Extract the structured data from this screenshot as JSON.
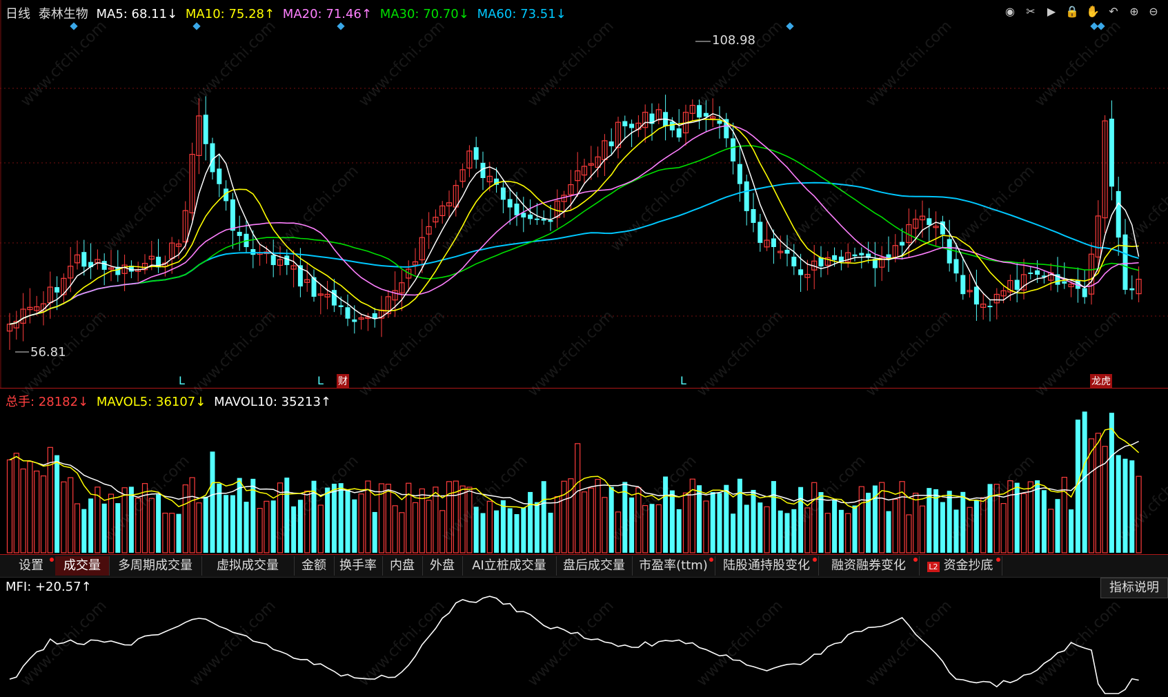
{
  "price_header": {
    "period": "日线",
    "stock_name": "泰林生物",
    "ma5": "MA5: 68.11↓",
    "ma10": "MA10: 75.28↑",
    "ma20": "MA20: 71.46↑",
    "ma30": "MA30: 70.70↓",
    "ma60": "MA60: 73.51↓"
  },
  "price_annotations": {
    "high": "108.98",
    "low": "56.81",
    "marker_l": "L",
    "marker_cai": "财",
    "marker_longhu": "龙虎"
  },
  "volume_header": {
    "total": "总手: 28182↓",
    "mavol5": "MAVOL5: 36107↓",
    "mavol10": "MAVOL10: 35213↑"
  },
  "tabs": [
    {
      "label": "设置",
      "dot": true
    },
    {
      "label": "成交量",
      "dot": false,
      "active": true
    },
    {
      "label": "多周期成交量",
      "dot": false
    },
    {
      "label": "虚拟成交量",
      "dot": false
    },
    {
      "label": "金额",
      "dot": false
    },
    {
      "label": "换手率",
      "dot": false
    },
    {
      "label": "内盘",
      "dot": false
    },
    {
      "label": "外盘",
      "dot": false
    },
    {
      "label": "AI立桩成交量",
      "dot": false
    },
    {
      "label": "盘后成交量",
      "dot": false
    },
    {
      "label": "市盈率(ttm)",
      "dot": true
    },
    {
      "label": "陆股通持股变化",
      "dot": true
    },
    {
      "label": "融资融券变化",
      "dot": true
    },
    {
      "label": "资金抄底",
      "dot": true,
      "badge": "L2"
    }
  ],
  "mfi_header": {
    "value": "MFI: +20.57↑"
  },
  "indicator_help": "指标说明",
  "watermark": "www.cfchi.com",
  "colors": {
    "up": "#ff3c3c",
    "down": "#54ffff",
    "ma5": "#ffffff",
    "ma10": "#ffff00",
    "ma20": "#ff80ff",
    "ma30": "#00e000",
    "ma60": "#00c8ff",
    "grid": "#7a1010"
  },
  "toolbar_icons": [
    "eye-icon",
    "scissors-icon",
    "play-icon",
    "lock-icon",
    "hand-icon",
    "undo-icon",
    "zoom-in-icon",
    "zoom-out-icon"
  ]
}
